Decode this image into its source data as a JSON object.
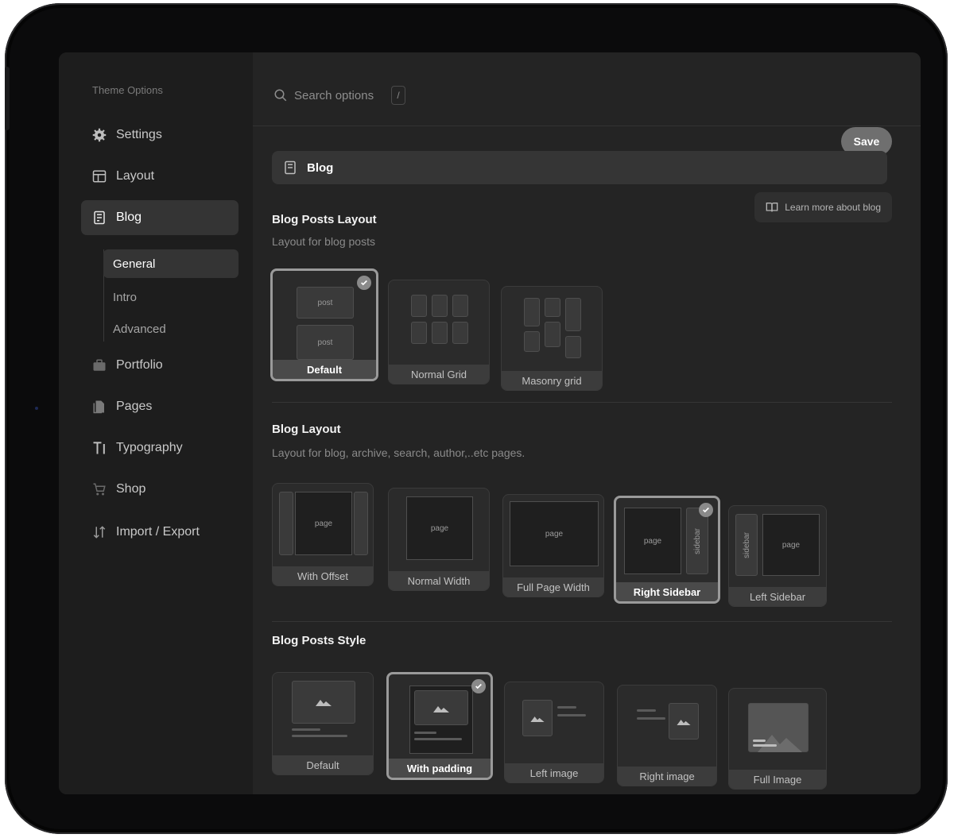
{
  "sidebar": {
    "title": "Theme Options",
    "items": [
      {
        "label": "Settings",
        "icon": "gear-icon"
      },
      {
        "label": "Layout",
        "icon": "layout-icon"
      },
      {
        "label": "Blog",
        "icon": "blog-icon",
        "active": true
      },
      {
        "label": "Portfolio",
        "icon": "briefcase-icon"
      },
      {
        "label": "Pages",
        "icon": "pages-icon"
      },
      {
        "label": "Typography",
        "icon": "typography-icon"
      },
      {
        "label": "Shop",
        "icon": "cart-icon"
      },
      {
        "label": "Import / Export",
        "icon": "import-export-icon"
      }
    ],
    "blog_subitems": [
      {
        "label": "General",
        "active": true
      },
      {
        "label": "Intro"
      },
      {
        "label": "Advanced"
      }
    ]
  },
  "search": {
    "placeholder": "Search options",
    "shortcut": "/"
  },
  "save_label": "Save",
  "section": {
    "title": "Blog",
    "learn_more": "Learn more about blog"
  },
  "blog_posts_layout": {
    "title": "Blog Posts Layout",
    "subtitle": "Layout for blog posts",
    "post_label": "post",
    "options": [
      "Default",
      "Normal Grid",
      "Masonry grid"
    ],
    "selected": "Default"
  },
  "blog_layout": {
    "title": "Blog Layout",
    "subtitle": "Layout for blog, archive, search, author,..etc pages.",
    "page_label": "page",
    "sidebar_label": "sidebar",
    "options": [
      "With Offset",
      "Normal Width",
      "Full Page Width",
      "Right Sidebar",
      "Left Sidebar"
    ],
    "selected": "Right Sidebar"
  },
  "blog_posts_style": {
    "title": "Blog Posts Style",
    "options": [
      "Default",
      "With padding",
      "Left image",
      "Right image",
      "Full Image"
    ],
    "selected": "With padding"
  },
  "colors": {
    "bg": "#242424",
    "sidebar": "#1d1d1d",
    "accent": "#9a9a9a"
  }
}
